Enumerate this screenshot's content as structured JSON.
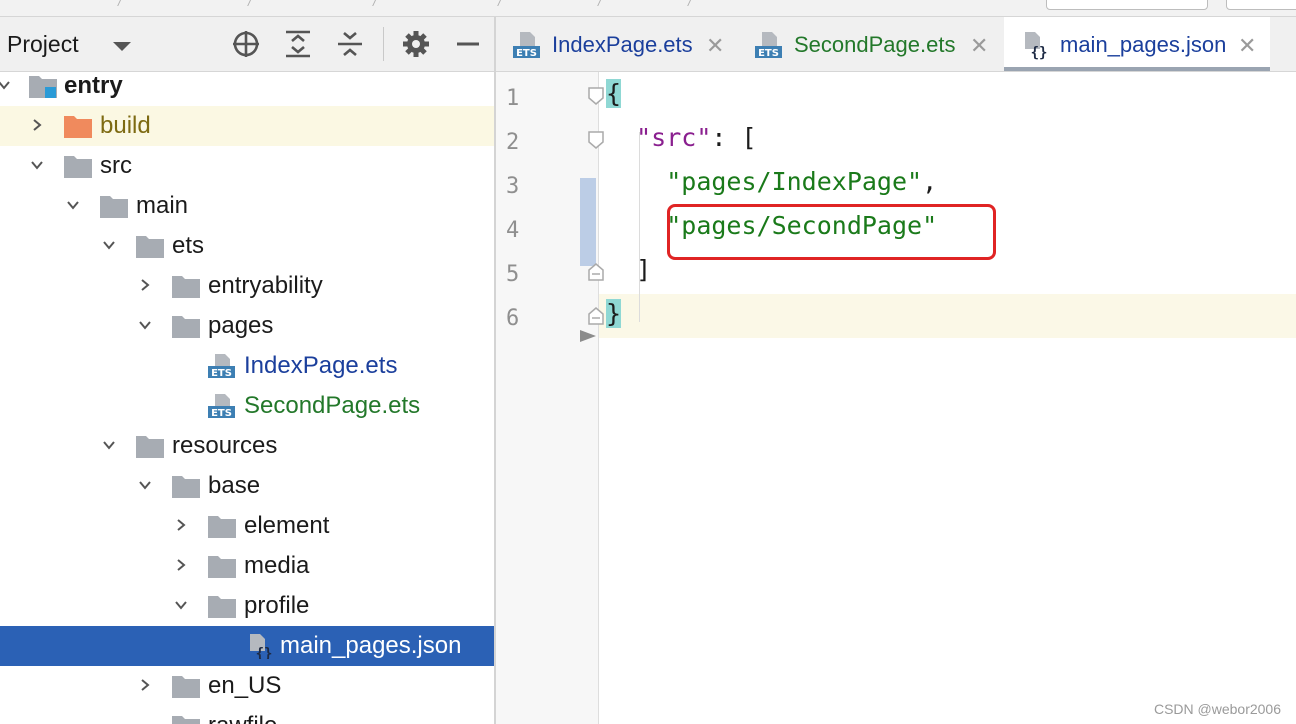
{
  "project_panel": {
    "title": "Project",
    "tools": [
      "locate-icon",
      "expand-all-icon",
      "collapse-all-icon",
      "gear-icon",
      "minimize-icon"
    ]
  },
  "tree": [
    {
      "label": "entry",
      "type": "module",
      "expanded": true
    },
    {
      "label": "build",
      "type": "folder-orange",
      "expanded": false
    },
    {
      "label": "src",
      "type": "folder",
      "expanded": true
    },
    {
      "label": "main",
      "type": "folder",
      "expanded": true
    },
    {
      "label": "ets",
      "type": "folder",
      "expanded": true
    },
    {
      "label": "entryability",
      "type": "folder",
      "expanded": false
    },
    {
      "label": "pages",
      "type": "folder",
      "expanded": true
    },
    {
      "label": "IndexPage.ets",
      "type": "ets-file"
    },
    {
      "label": "SecondPage.ets",
      "type": "ets-file"
    },
    {
      "label": "resources",
      "type": "folder",
      "expanded": true
    },
    {
      "label": "base",
      "type": "folder",
      "expanded": true
    },
    {
      "label": "element",
      "type": "folder",
      "expanded": false
    },
    {
      "label": "media",
      "type": "folder",
      "expanded": false
    },
    {
      "label": "profile",
      "type": "folder",
      "expanded": true
    },
    {
      "label": "main_pages.json",
      "type": "json-file",
      "selected": true
    },
    {
      "label": "en_US",
      "type": "folder",
      "expanded": false
    },
    {
      "label": "rawfile",
      "type": "folder"
    }
  ],
  "tabs": [
    {
      "label": "IndexPage.ets",
      "icon": "ets-file-icon",
      "color": "#1b3f9c"
    },
    {
      "label": "SecondPage.ets",
      "icon": "ets-file-icon",
      "color": "#23782a"
    },
    {
      "label": "main_pages.json",
      "icon": "json-file-icon",
      "color": "#1b3f9c",
      "active": true
    }
  ],
  "editor": {
    "line_numbers": [
      "1",
      "2",
      "3",
      "4",
      "5",
      "6"
    ],
    "lines": {
      "l1": "{",
      "l2_key": "\"src\"",
      "l2_rest": ": [",
      "l3_str": "\"pages/IndexPage\"",
      "l3_rest": ",",
      "l4_str": "\"pages/SecondPage\"",
      "l5": "]",
      "l6": "}"
    }
  },
  "watermark": "CSDN @webor2006",
  "colors": {
    "selection": "#2b61b5",
    "highlight_red": "#e02424",
    "string_green": "#1a7a1a",
    "key_purple": "#8a1f8f"
  }
}
